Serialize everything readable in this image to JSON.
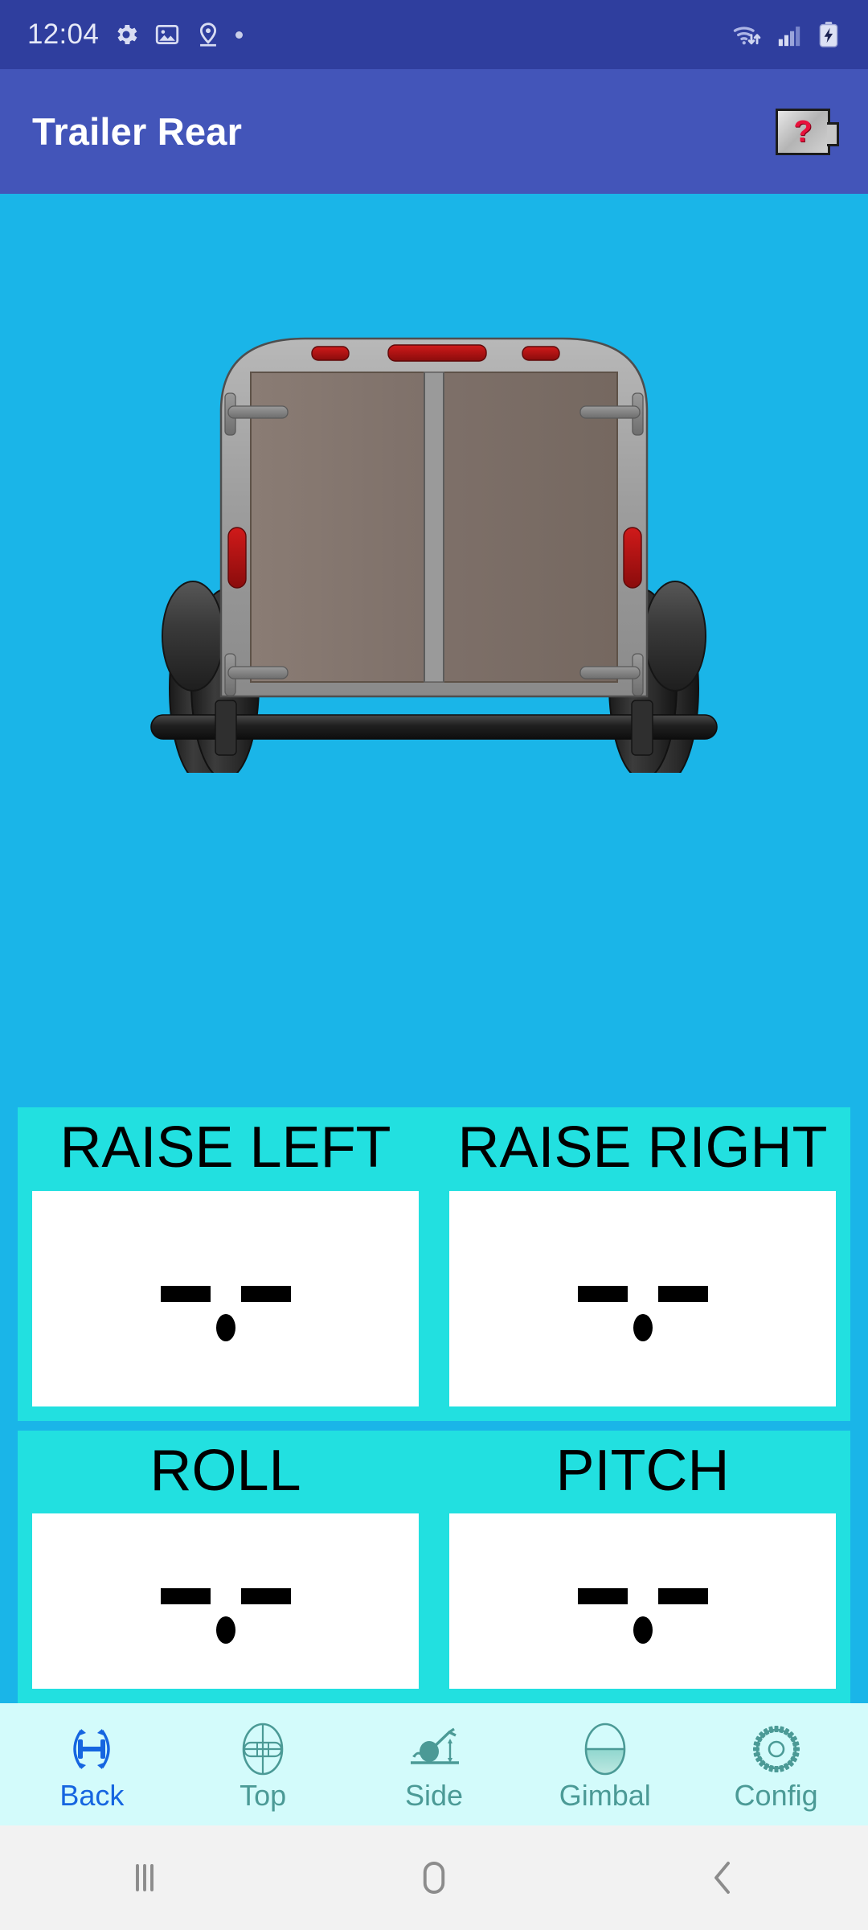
{
  "status_bar": {
    "clock": "12:04",
    "left_icons": [
      "gear-icon",
      "image-icon",
      "location-pin-icon",
      "dot-indicator"
    ],
    "right_icons": [
      "wifi-data-icon",
      "cellular-signal-icon",
      "battery-charging-icon"
    ],
    "background_color": "#2F3E9E"
  },
  "app_bar": {
    "title": "Trailer Rear",
    "help_symbol": "?",
    "help_icon_name": "help-question-icon",
    "background_color": "#4355B9",
    "title_color": "#FFFFFF"
  },
  "illustration": {
    "name": "trailer-rear-view-diagram",
    "background_color": "#1AB5E8",
    "body_color": "#9C9C9C",
    "door_color": "#7E7069",
    "lamp_color": "#B01717",
    "tire_color": "#2B2B2B"
  },
  "panels": [
    {
      "panel_name": "raise-controls-panel",
      "background_color": "#22E0E0",
      "cells": [
        {
          "label": "RAISE LEFT",
          "value": "-.-",
          "readout_name": "raise-left-readout"
        },
        {
          "label": "RAISE RIGHT",
          "value": "-.-",
          "readout_name": "raise-right-readout"
        }
      ]
    },
    {
      "panel_name": "attitude-panel",
      "background_color": "#22E0E0",
      "cells": [
        {
          "label": "ROLL",
          "value": "-.-",
          "readout_name": "roll-readout"
        },
        {
          "label": "PITCH",
          "value": "-.-",
          "readout_name": "pitch-readout"
        }
      ]
    }
  ],
  "bottom_nav": {
    "background_color": "#D3FBFB",
    "active_color": "#1565E0",
    "idle_color": "#4B9A96",
    "items": [
      {
        "label": "Back",
        "icon": "axle-rotation-icon",
        "active": true
      },
      {
        "label": "Top",
        "icon": "level-crosshair-icon",
        "active": false
      },
      {
        "label": "Side",
        "icon": "trailer-side-icon",
        "active": false
      },
      {
        "label": "Gimbal",
        "icon": "bubble-level-icon",
        "active": false
      },
      {
        "label": "Config",
        "icon": "gear-icon",
        "active": false
      }
    ]
  },
  "system_nav": {
    "background_color": "#F2F2F2",
    "buttons": [
      {
        "name": "recents-button",
        "icon": "three-bars-icon"
      },
      {
        "name": "home-button",
        "icon": "rounded-square-icon"
      },
      {
        "name": "back-button",
        "icon": "chevron-left-icon"
      }
    ]
  }
}
